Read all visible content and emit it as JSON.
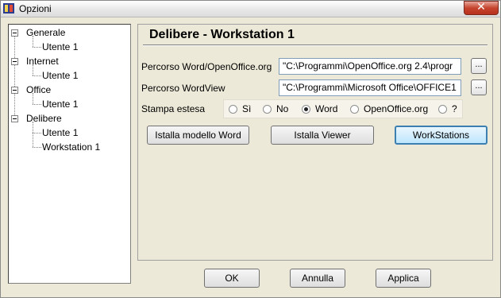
{
  "window": {
    "title": "Opzioni"
  },
  "tree": {
    "items": [
      {
        "label": "Generale",
        "children": [
          "Utente  1"
        ]
      },
      {
        "label": "Internet",
        "children": [
          "Utente  1"
        ]
      },
      {
        "label": "Office",
        "children": [
          "Utente  1"
        ]
      },
      {
        "label": "Delibere",
        "children": [
          "Utente  1",
          "Workstation  1"
        ]
      }
    ],
    "selected": "Workstation  1"
  },
  "panel": {
    "title": "Delibere - Workstation  1",
    "word_path_label": "Percorso Word/OpenOffice.org",
    "word_path_value": "\"C:\\Programmi\\OpenOffice.org 2.4\\progr",
    "wordview_path_label": "Percorso WordView",
    "wordview_path_value": "\"C:\\Programmi\\Microsoft Office\\OFFICE1",
    "browse_label": "...",
    "print_label": "Stampa estesa",
    "print_options": [
      "Sì",
      "No",
      "Word",
      "OpenOffice.org",
      "?"
    ],
    "print_selected": "Word",
    "install_word_label": "Istalla modello Word",
    "install_viewer_label": "Istalla Viewer",
    "workstations_label": "WorkStations"
  },
  "footer": {
    "ok_label": "OK",
    "cancel_label": "Annulla",
    "apply_label": "Applica"
  }
}
